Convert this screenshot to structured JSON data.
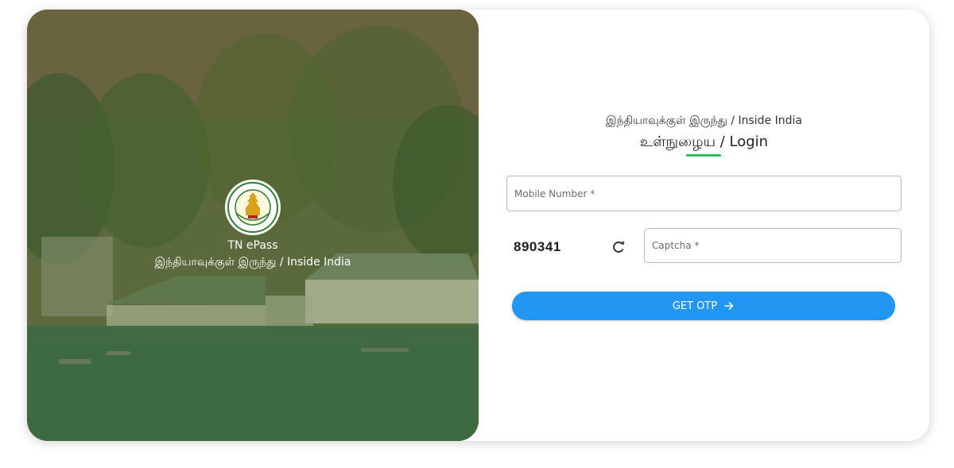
{
  "hero": {
    "app_name": "TN ePass",
    "subtitle": "இந்தியாவுக்குள் இருந்து / Inside India"
  },
  "login": {
    "subtitle": "இந்தியாவுக்குள் இருந்து / Inside India",
    "title": "உள்நுழைய / Login",
    "mobile_placeholder": "Mobile Number *",
    "captcha_code": "890341",
    "captcha_placeholder": "Captcha *",
    "otp_button_label": "GET OTP"
  },
  "colors": {
    "accent_green": "#2fbe5a",
    "button_blue": "#2196f3",
    "hero_overlay": "#4f6d3a"
  },
  "icons": {
    "refresh": "refresh-icon",
    "arrow": "arrow-right-icon",
    "emblem": "tn-emblem-icon"
  }
}
